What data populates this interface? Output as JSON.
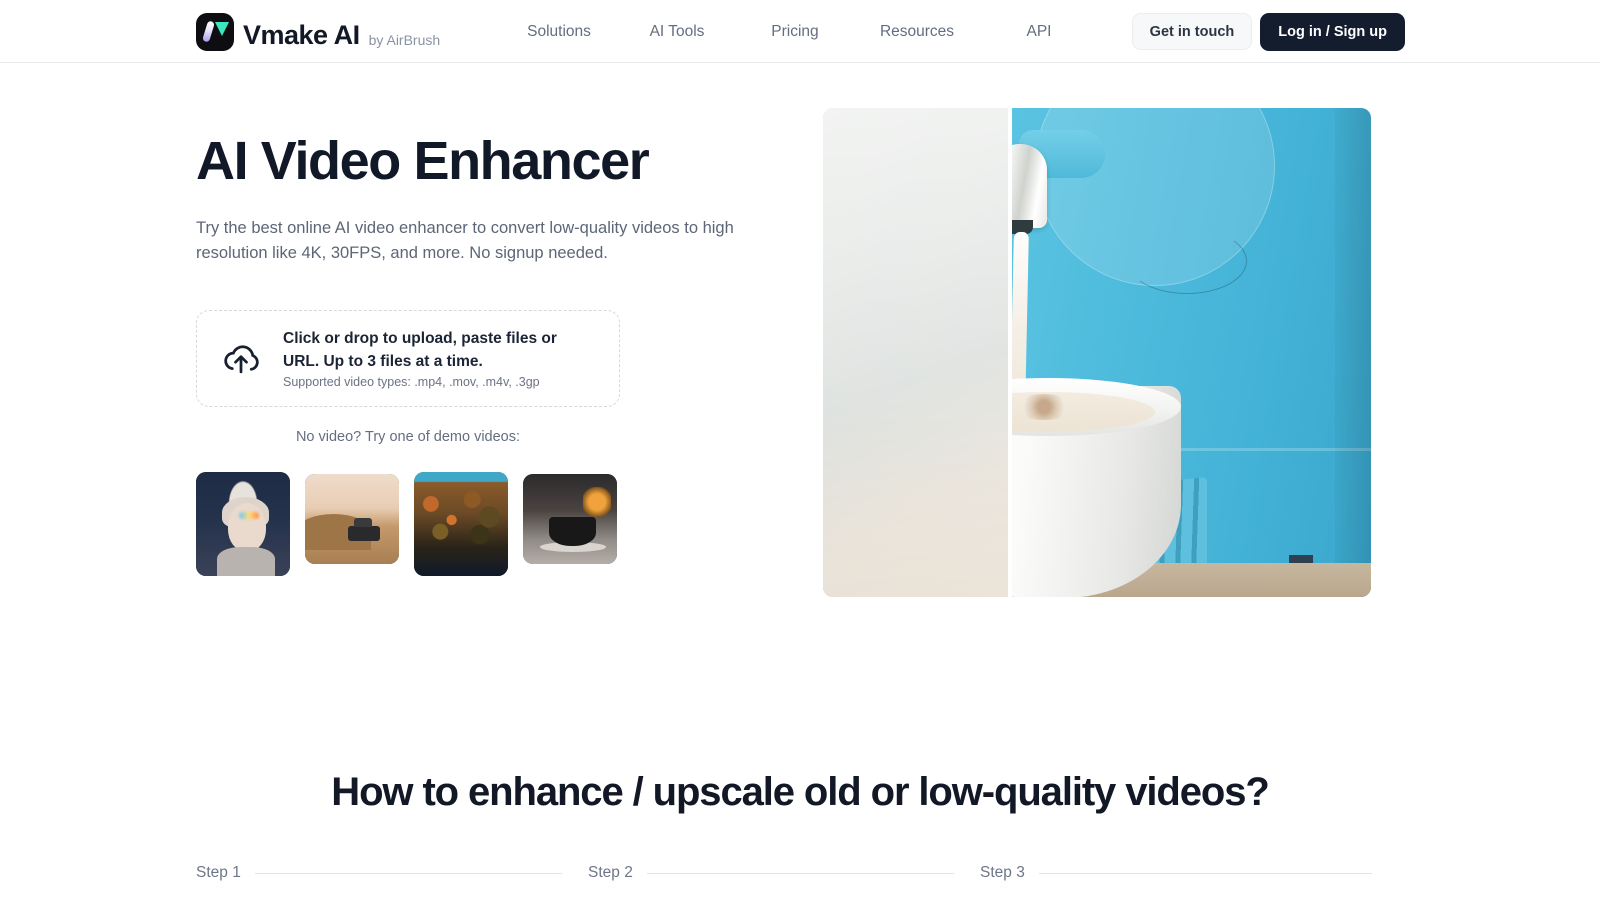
{
  "header": {
    "brand_name": "Vmake AI",
    "brand_by": "by AirBrush",
    "logo_icon": "vmake-logo-icon",
    "nav": [
      {
        "label": "Solutions"
      },
      {
        "label": "AI Tools"
      },
      {
        "label": "Pricing"
      },
      {
        "label": "Resources"
      },
      {
        "label": "API"
      }
    ],
    "get_in_touch_label": "Get in touch",
    "login_signup_label": "Log in / Sign up"
  },
  "hero": {
    "title": "AI Video Enhancer",
    "subtitle": "Try the best online AI video enhancer to convert low-quality videos to high resolution like 4K, 30FPS, and more. No signup needed.",
    "upload": {
      "icon": "cloud-upload-icon",
      "main_text": "Click or drop to upload, paste files or URL. Up to 3 files at a time.",
      "sub_text": "Supported video types: .mp4, .mov, .m4v, .3gp"
    },
    "demo_label": "No video? Try one of demo videos:",
    "demos": [
      {
        "name": "demo-video-portrait-woman"
      },
      {
        "name": "demo-video-desert-truck"
      },
      {
        "name": "demo-video-autumn-landscape"
      },
      {
        "name": "demo-video-coffee-cup"
      }
    ],
    "comparison_image": {
      "name": "before-after-coffee-machine",
      "before_label": "",
      "after_label": ""
    }
  },
  "how_to": {
    "title": "How to enhance / upscale old or low-quality videos?",
    "steps": [
      {
        "label": "Step 1"
      },
      {
        "label": "Step 2"
      },
      {
        "label": "Step 3"
      }
    ]
  },
  "colors": {
    "brand_dark": "#141d2e",
    "text_primary": "#121826",
    "text_muted": "#646e80",
    "accent_teal": "#3ae8c0",
    "accent_purple": "#a99ae6",
    "border": "#e9eaec"
  }
}
